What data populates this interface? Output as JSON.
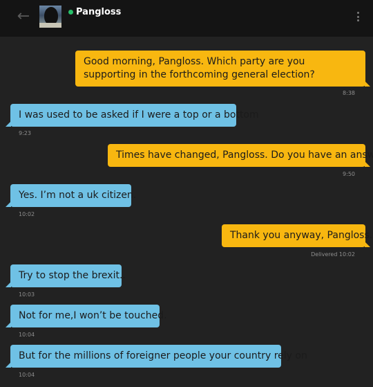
{
  "header": {
    "back_icon": "arrow-left-icon",
    "contact_name": "Pangloss",
    "status_color": "#27c06a",
    "menu_icon": "more-vertical-icon"
  },
  "colors": {
    "outgoing_bubble": "#f8b710",
    "incoming_bubble": "#6fc1e5",
    "background": "#222222",
    "header": "#141414"
  },
  "messages": [
    {
      "direction": "out",
      "text": "Good morning, Pangloss. Which party are you supporting in the forthcoming general election?",
      "time": "8:38"
    },
    {
      "direction": "in",
      "text": "I was used to be asked if I were a top or a bottom",
      "time": "9:23"
    },
    {
      "direction": "out",
      "text": "Times have changed, Pangloss. Do you have an answer?",
      "time": "9:50"
    },
    {
      "direction": "in",
      "text": "Yes. I’m not a uk citizen.",
      "time": "10:02"
    },
    {
      "direction": "out",
      "text": "Thank you anyway, Pangloss.",
      "time": "Delivered 10:02"
    },
    {
      "direction": "in",
      "text": "Try to stop the brexit..",
      "time": "10:03"
    },
    {
      "direction": "in",
      "text": "Not for me,I won’t be touched.",
      "time": "10:04"
    },
    {
      "direction": "in",
      "text": "But for the millions of foreigner people your country rely on",
      "time": "10:04"
    }
  ]
}
